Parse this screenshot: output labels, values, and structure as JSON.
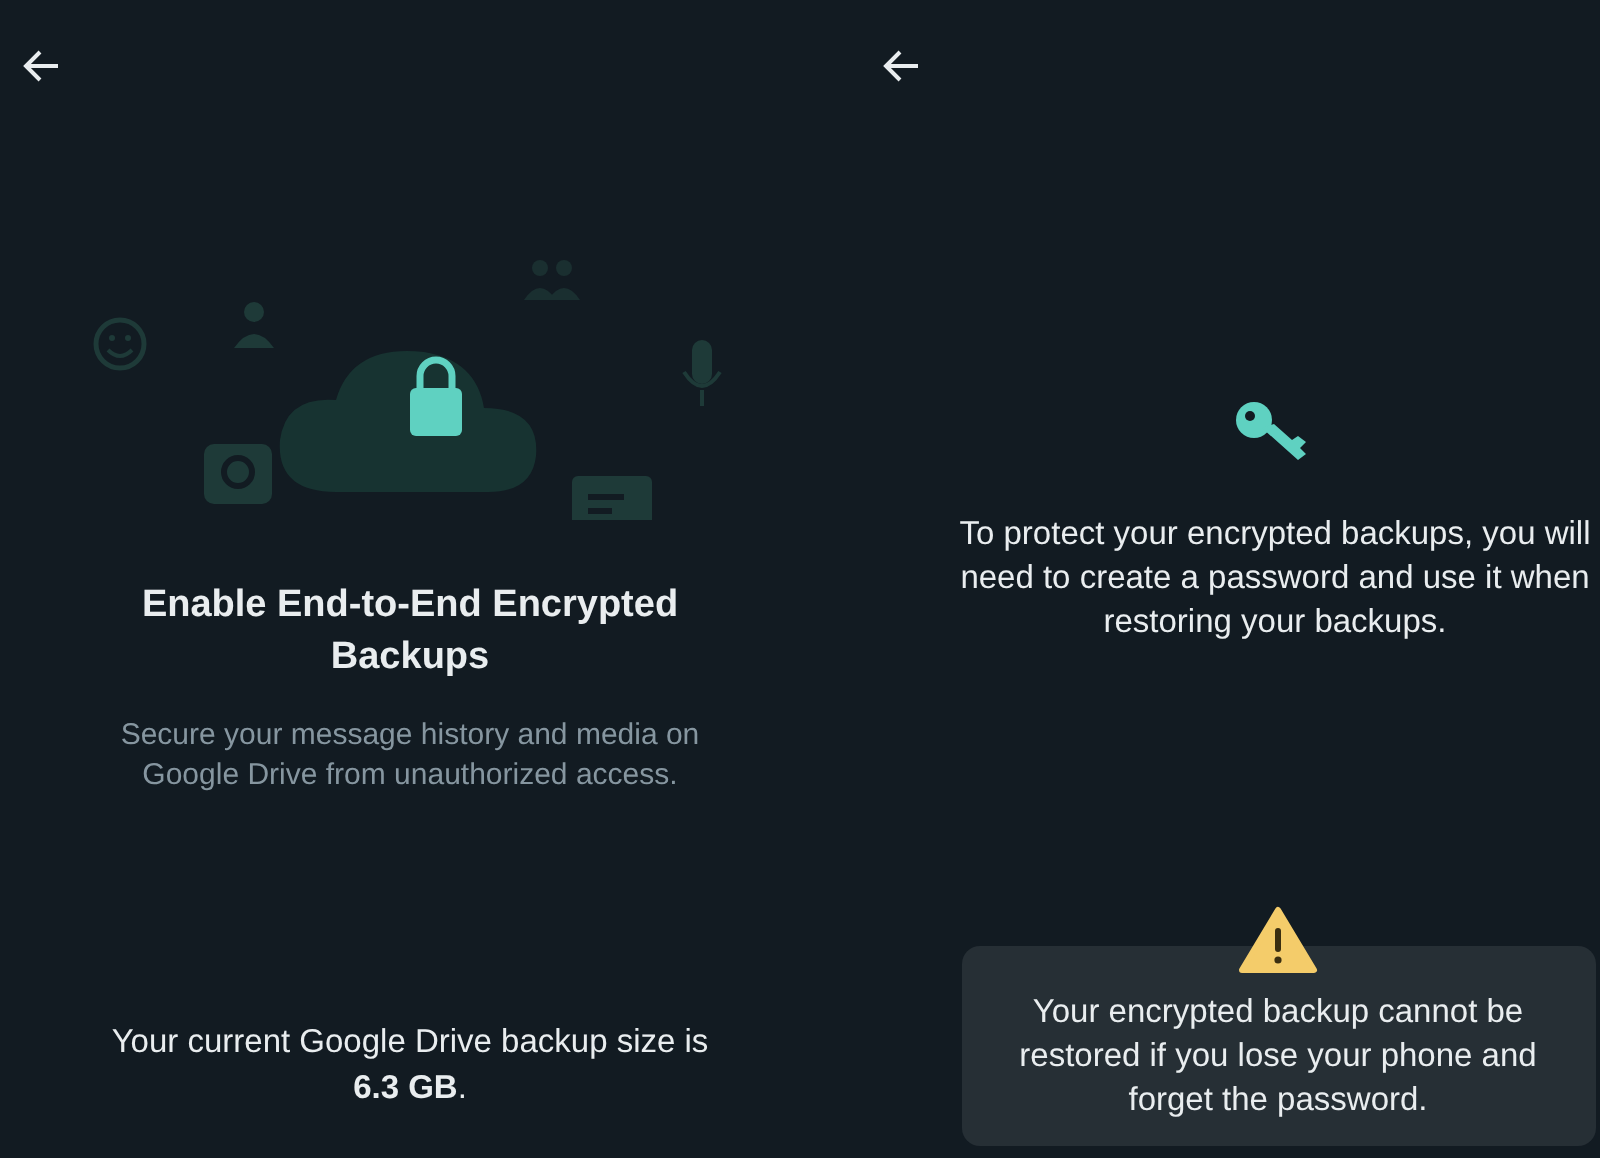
{
  "left_screen": {
    "title": "Enable End-to-End Encrypted Backups",
    "description": "Secure your message history and media on Google Drive from unauthorized access.",
    "backup_size": "Your current Google Drive backup size is **6.3 GB**."
  },
  "right_screen": {
    "message": "To protect your encrypted backups, you will need to create a password and use it when restoring your backups.",
    "warning": "Your encrypted backup cannot be restored if you lose your phone and forget the password."
  }
}
